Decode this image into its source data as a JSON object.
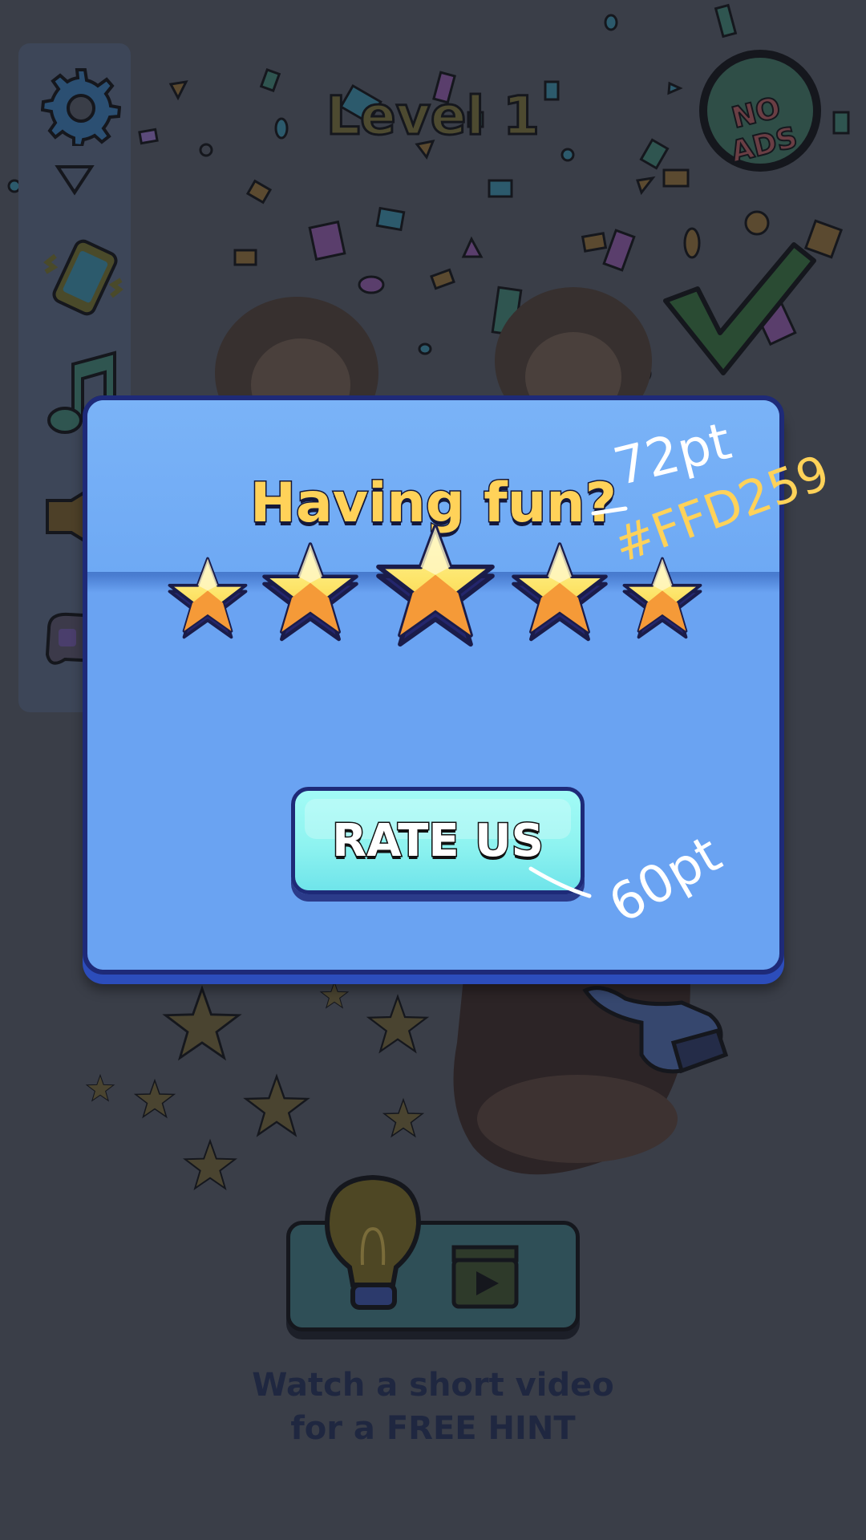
{
  "game": {
    "level_title": "Level 1",
    "no_ads_label": "NO ADS"
  },
  "sidebar": {
    "buttons": [
      {
        "icon": "gear-icon"
      },
      {
        "icon": "vibration-icon"
      },
      {
        "icon": "music-note-icon"
      },
      {
        "icon": "sound-icon"
      },
      {
        "icon": "controller-icon"
      }
    ]
  },
  "hint": {
    "caption_line1": "Watch a short video",
    "caption_line2": "for a FREE HINT",
    "icons": [
      "lightbulb-icon",
      "video-clapper-icon"
    ]
  },
  "rating_modal": {
    "title": "Having fun?",
    "title_color": "#FFD259",
    "stars": 5,
    "button_label": "RATE US"
  },
  "annotations": {
    "title_size_note": "72pt",
    "title_color_note": "#FFD259",
    "button_size_note": "60pt"
  },
  "colors": {
    "overlay_background": "#3a3e48",
    "modal_fill": "#6aa3f2",
    "modal_outline": "#1e2a78",
    "button_fill": "#8ef3f0",
    "star_light": "#fde468",
    "star_dark": "#f59a38"
  }
}
